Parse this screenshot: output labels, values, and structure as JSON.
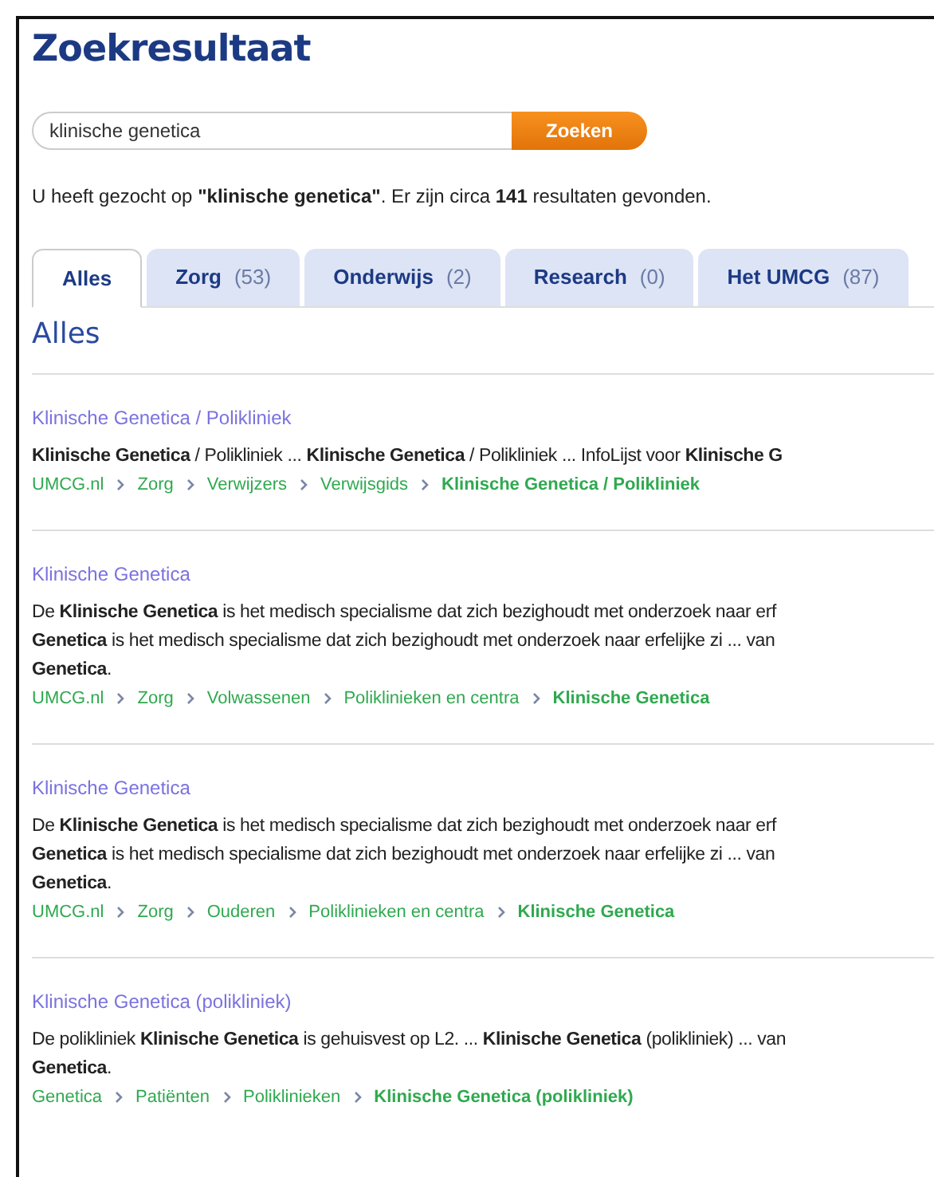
{
  "title": "Zoekresultaat",
  "search": {
    "value": "klinische genetica",
    "button": "Zoeken"
  },
  "summary": "U heeft gezocht op **\"klinische genetica\"**. Er zijn circa **141** resultaten gevonden.",
  "tabs": [
    {
      "label": "Alles",
      "selected": true
    },
    {
      "label": "Zorg",
      "count": "(53)",
      "selected": false
    },
    {
      "label": "Onderwijs",
      "count": "(2)",
      "selected": false
    },
    {
      "label": "Research",
      "count": "(0)",
      "selected": false
    },
    {
      "label": "Het UMCG",
      "count": "(87)",
      "selected": false
    }
  ],
  "section_heading": "Alles",
  "results": [
    {
      "title": "Klinische Genetica / Polikliniek",
      "snippet": [
        "**Klinische Genetica** / Polikliniek ... **Klinische Genetica** / Polikliniek ... InfoLijst voor **Klinische G**"
      ],
      "breadcrumb": [
        "UMCG.nl",
        "Zorg",
        "Verwijzers",
        "Verwijsgids",
        "Klinische Genetica / Polikliniek"
      ]
    },
    {
      "title": "Klinische Genetica",
      "snippet": [
        "De **Klinische Genetica** is het medisch specialisme dat zich bezighoudt met onderzoek naar erf",
        "**Genetica** is het medisch specialisme dat zich bezighoudt met onderzoek naar erfelijke zi ... van",
        "**Genetica**."
      ],
      "breadcrumb": [
        "UMCG.nl",
        "Zorg",
        "Volwassenen",
        "Poliklinieken en centra",
        "Klinische Genetica"
      ]
    },
    {
      "title": "Klinische Genetica",
      "snippet": [
        "De **Klinische Genetica** is het medisch specialisme dat zich bezighoudt met onderzoek naar erf",
        "**Genetica** is het medisch specialisme dat zich bezighoudt met onderzoek naar erfelijke zi ... van",
        "**Genetica**."
      ],
      "breadcrumb": [
        "UMCG.nl",
        "Zorg",
        "Ouderen",
        "Poliklinieken en centra",
        "Klinische Genetica"
      ]
    },
    {
      "title": "Klinische Genetica (polikliniek)",
      "snippet": [
        "De polikliniek **Klinische Genetica** is gehuisvest op L2. ... **Klinische Genetica** (polikliniek) ... van",
        "**Genetica**."
      ],
      "breadcrumb": [
        "Genetica",
        "Patiënten",
        "Poliklinieken",
        "Klinische Genetica (polikliniek)"
      ]
    }
  ]
}
